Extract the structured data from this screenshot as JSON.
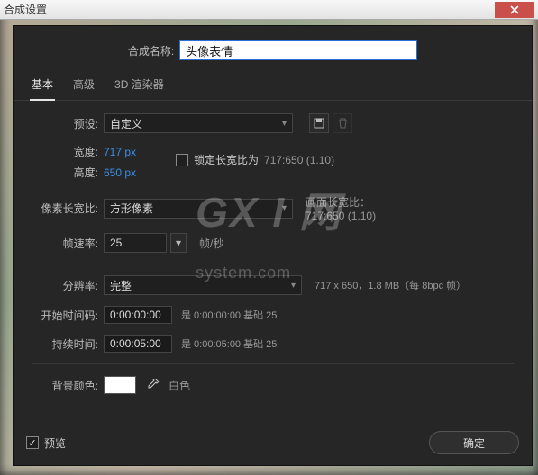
{
  "window": {
    "title": "合成设置"
  },
  "compName": {
    "label": "合成名称:",
    "value": "头像表情"
  },
  "tabs": {
    "basic": "基本",
    "advanced": "高级",
    "renderer": "3D 渲染器"
  },
  "preset": {
    "label": "预设:",
    "value": "自定义"
  },
  "width": {
    "label": "宽度:",
    "value": "717",
    "unit": "px"
  },
  "height": {
    "label": "高度:",
    "value": "650",
    "unit": "px"
  },
  "lockAspect": {
    "label": "锁定长宽比为",
    "ratio": "717:650 (1.10)"
  },
  "par": {
    "label": "像素长宽比:",
    "value": "方形像素"
  },
  "frameAspect": {
    "label": "画面长宽比：",
    "ratio": "717:650 (1.10)"
  },
  "fps": {
    "label": "帧速率:",
    "value": "25",
    "unit": "帧/秒"
  },
  "resolution": {
    "label": "分辨率:",
    "value": "完整",
    "info": "717 x 650，1.8 MB（每 8bpc 帧）"
  },
  "startTC": {
    "label": "开始时间码:",
    "value": "0:00:00:00",
    "note": "是 0:00:00:00  基础 25"
  },
  "duration": {
    "label": "持续时间:",
    "value": "0:00:05:00",
    "note": "是 0:00:05:00  基础 25"
  },
  "bg": {
    "label": "背景颜色:",
    "name": "白色"
  },
  "footer": {
    "preview": "预览",
    "ok": "确定"
  },
  "watermark": {
    "big": "GX I 网",
    "small": "system.com"
  }
}
